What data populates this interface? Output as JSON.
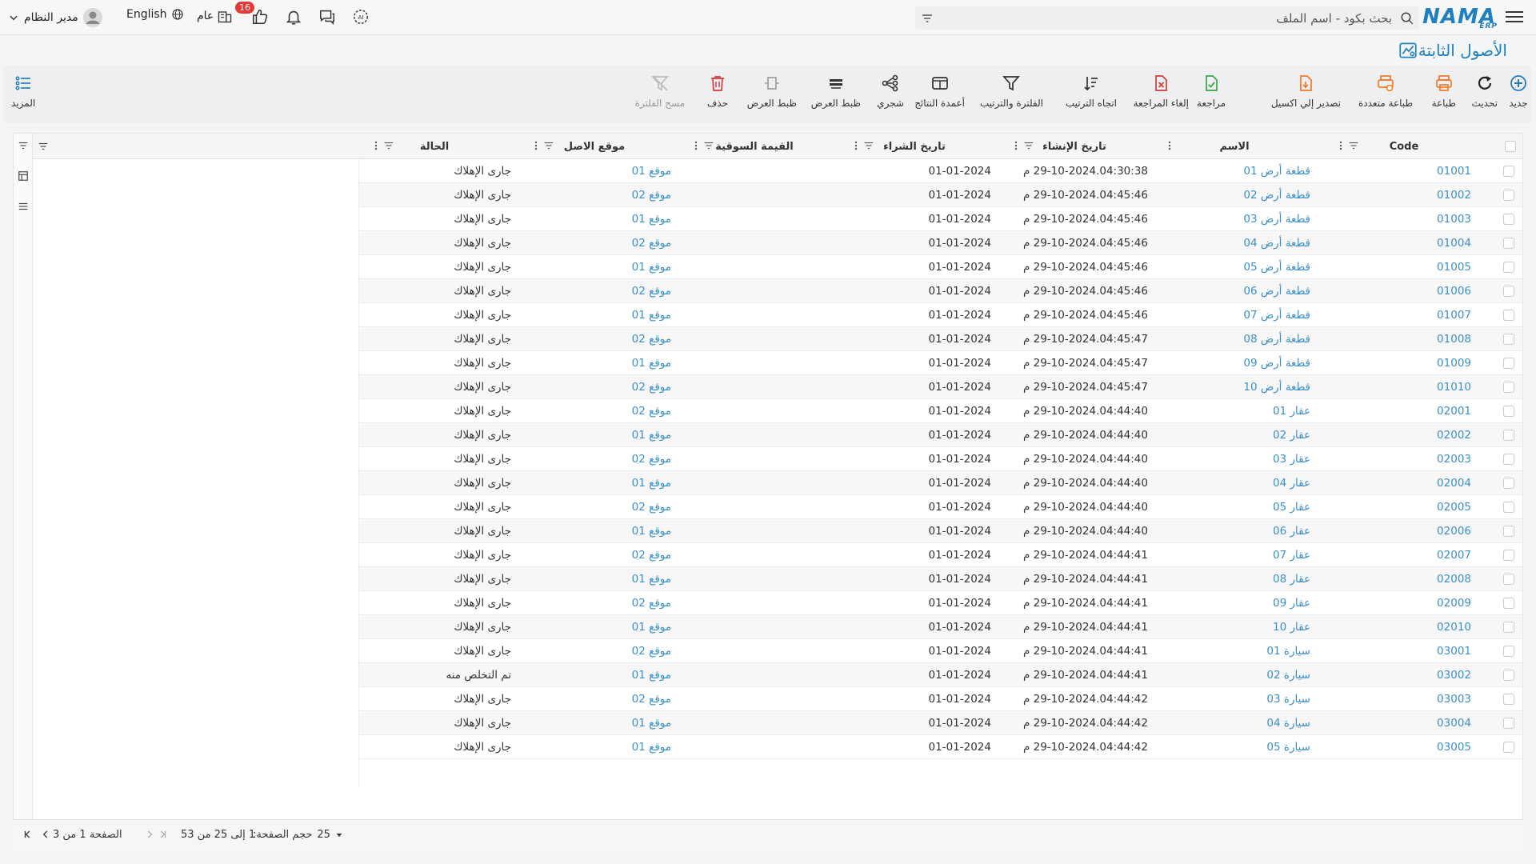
{
  "header": {
    "logo": "NAMA",
    "logo_sub": "ERP",
    "search_placeholder": "بحث بكود - اسم الملف",
    "badge_count": "16",
    "general_label": "عام",
    "language_label": "English",
    "user_name": "مدير النظام"
  },
  "page": {
    "title": "الأصول الثابتة"
  },
  "toolbar": {
    "new": "جديد",
    "refresh": "تحديث",
    "print": "طباعة",
    "multi_print": "طباعة متعددة",
    "export_excel": "تصدير إلي اكسيل",
    "review": "مراجعة",
    "cancel_review": "إلغاء المراجعة",
    "sort_direction": "اتجاه الترتيب",
    "filter_sort": "الفلترة والترتيب",
    "result_columns": "أعمدة النتائج",
    "tree": "شجري",
    "fit_width_1": "ظبط العرض",
    "fit_width_2": "ظبط العرض",
    "delete": "حذف",
    "clear_filter": "مسح الفلترة",
    "more": "المزيد"
  },
  "table": {
    "columns": {
      "code": "Code",
      "name": "الاسم",
      "created": "تاريخ الإنشاء",
      "purchase_date": "تاريخ الشراء",
      "market_value": "القيمة السوقية",
      "location": "موقع الاصل",
      "status": "الحالة"
    },
    "rows": [
      {
        "code": "01001",
        "name": "قطعة أرض 01",
        "created": "29-10-2024.04:30:38 م",
        "purchase": "01-01-2024",
        "value": "",
        "location": "موقع 01",
        "status": "جارى الإهلاك"
      },
      {
        "code": "01002",
        "name": "قطعة أرض 02",
        "created": "29-10-2024.04:45:46 م",
        "purchase": "01-01-2024",
        "value": "",
        "location": "موقع 02",
        "status": "جارى الإهلاك"
      },
      {
        "code": "01003",
        "name": "قطعة أرض 03",
        "created": "29-10-2024.04:45:46 م",
        "purchase": "01-01-2024",
        "value": "",
        "location": "موقع 01",
        "status": "جارى الإهلاك"
      },
      {
        "code": "01004",
        "name": "قطعة أرض 04",
        "created": "29-10-2024.04:45:46 م",
        "purchase": "01-01-2024",
        "value": "",
        "location": "موقع 02",
        "status": "جارى الإهلاك"
      },
      {
        "code": "01005",
        "name": "قطعة أرض 05",
        "created": "29-10-2024.04:45:46 م",
        "purchase": "01-01-2024",
        "value": "",
        "location": "موقع 01",
        "status": "جارى الإهلاك"
      },
      {
        "code": "01006",
        "name": "قطعة أرض 06",
        "created": "29-10-2024.04:45:46 م",
        "purchase": "01-01-2024",
        "value": "",
        "location": "موقع 02",
        "status": "جارى الإهلاك"
      },
      {
        "code": "01007",
        "name": "قطعة أرض 07",
        "created": "29-10-2024.04:45:46 م",
        "purchase": "01-01-2024",
        "value": "",
        "location": "موقع 01",
        "status": "جارى الإهلاك"
      },
      {
        "code": "01008",
        "name": "قطعة أرض 08",
        "created": "29-10-2024.04:45:47 م",
        "purchase": "01-01-2024",
        "value": "",
        "location": "موقع 02",
        "status": "جارى الإهلاك"
      },
      {
        "code": "01009",
        "name": "قطعة أرض 09",
        "created": "29-10-2024.04:45:47 م",
        "purchase": "01-01-2024",
        "value": "",
        "location": "موقع 01",
        "status": "جارى الإهلاك"
      },
      {
        "code": "01010",
        "name": "قطعة أرض 10",
        "created": "29-10-2024.04:45:47 م",
        "purchase": "01-01-2024",
        "value": "",
        "location": "موقع 02",
        "status": "جارى الإهلاك"
      },
      {
        "code": "02001",
        "name": "عقار 01",
        "created": "29-10-2024.04:44:40 م",
        "purchase": "01-01-2024",
        "value": "",
        "location": "موقع 02",
        "status": "جارى الإهلاك"
      },
      {
        "code": "02002",
        "name": "عقار 02",
        "created": "29-10-2024.04:44:40 م",
        "purchase": "01-01-2024",
        "value": "",
        "location": "موقع 01",
        "status": "جارى الإهلاك"
      },
      {
        "code": "02003",
        "name": "عقار 03",
        "created": "29-10-2024.04:44:40 م",
        "purchase": "01-01-2024",
        "value": "",
        "location": "موقع 02",
        "status": "جارى الإهلاك"
      },
      {
        "code": "02004",
        "name": "عقار 04",
        "created": "29-10-2024.04:44:40 م",
        "purchase": "01-01-2024",
        "value": "",
        "location": "موقع 01",
        "status": "جارى الإهلاك"
      },
      {
        "code": "02005",
        "name": "عقار 05",
        "created": "29-10-2024.04:44:40 م",
        "purchase": "01-01-2024",
        "value": "",
        "location": "موقع 02",
        "status": "جارى الإهلاك"
      },
      {
        "code": "02006",
        "name": "عقار 06",
        "created": "29-10-2024.04:44:40 م",
        "purchase": "01-01-2024",
        "value": "",
        "location": "موقع 01",
        "status": "جارى الإهلاك"
      },
      {
        "code": "02007",
        "name": "عقار 07",
        "created": "29-10-2024.04:44:41 م",
        "purchase": "01-01-2024",
        "value": "",
        "location": "موقع 02",
        "status": "جارى الإهلاك"
      },
      {
        "code": "02008",
        "name": "عقار 08",
        "created": "29-10-2024.04:44:41 م",
        "purchase": "01-01-2024",
        "value": "",
        "location": "موقع 01",
        "status": "جارى الإهلاك"
      },
      {
        "code": "02009",
        "name": "عقار 09",
        "created": "29-10-2024.04:44:41 م",
        "purchase": "01-01-2024",
        "value": "",
        "location": "موقع 02",
        "status": "جارى الإهلاك"
      },
      {
        "code": "02010",
        "name": "عقار 10",
        "created": "29-10-2024.04:44:41 م",
        "purchase": "01-01-2024",
        "value": "",
        "location": "موقع 01",
        "status": "جارى الإهلاك"
      },
      {
        "code": "03001",
        "name": "سيارة 01",
        "created": "29-10-2024.04:44:41 م",
        "purchase": "01-01-2024",
        "value": "",
        "location": "موقع 02",
        "status": "جارى الإهلاك"
      },
      {
        "code": "03002",
        "name": "سيارة 02",
        "created": "29-10-2024.04:44:41 م",
        "purchase": "01-01-2024",
        "value": "",
        "location": "موقع 01",
        "status": "تم التخلص منه"
      },
      {
        "code": "03003",
        "name": "سيارة 03",
        "created": "29-10-2024.04:44:42 م",
        "purchase": "01-01-2024",
        "value": "",
        "location": "موقع 02",
        "status": "جارى الإهلاك"
      },
      {
        "code": "03004",
        "name": "سيارة 04",
        "created": "29-10-2024.04:44:42 م",
        "purchase": "01-01-2024",
        "value": "",
        "location": "موقع 01",
        "status": "جارى الإهلاك"
      },
      {
        "code": "03005",
        "name": "سيارة 05",
        "created": "29-10-2024.04:44:42 م",
        "purchase": "01-01-2024",
        "value": "",
        "location": "موقع 01",
        "status": "جارى الإهلاك"
      }
    ]
  },
  "footer": {
    "page_size_label": "حجم الصفحة:",
    "page_size_value": "25",
    "range_text": "1 إلى 25 من 53",
    "page_text": "الصفحة 1 من 3"
  },
  "colors": {
    "accent": "#1f7fbf",
    "link": "#3a8fc9",
    "orange": "#f07a2a",
    "green": "#3aa64a",
    "red": "#d33c3c"
  }
}
